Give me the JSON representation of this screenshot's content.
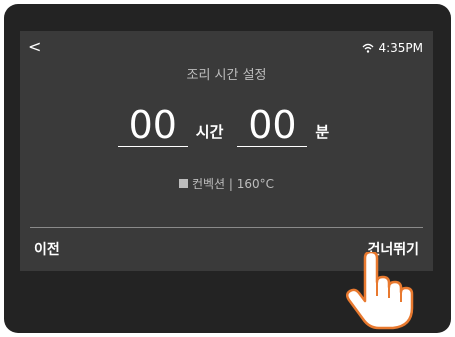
{
  "header": {
    "back_label": "<",
    "time": "4:35PM"
  },
  "screen": {
    "title": "조리 시간 설정",
    "hours_value": "00",
    "hours_unit": "시간",
    "minutes_value": "00",
    "minutes_unit": "분",
    "mode_text": "컨벡션 | 160°C"
  },
  "footer": {
    "prev_label": "이전",
    "skip_label": "건너뛰기"
  },
  "icons": [
    "back-icon",
    "wifi-icon",
    "convection-icon",
    "hand-pointer-icon"
  ],
  "colors": {
    "bezel": "#232323",
    "screen": "#3a3a3a",
    "text": "#ffffff",
    "subtext": "#bdbdbd"
  }
}
